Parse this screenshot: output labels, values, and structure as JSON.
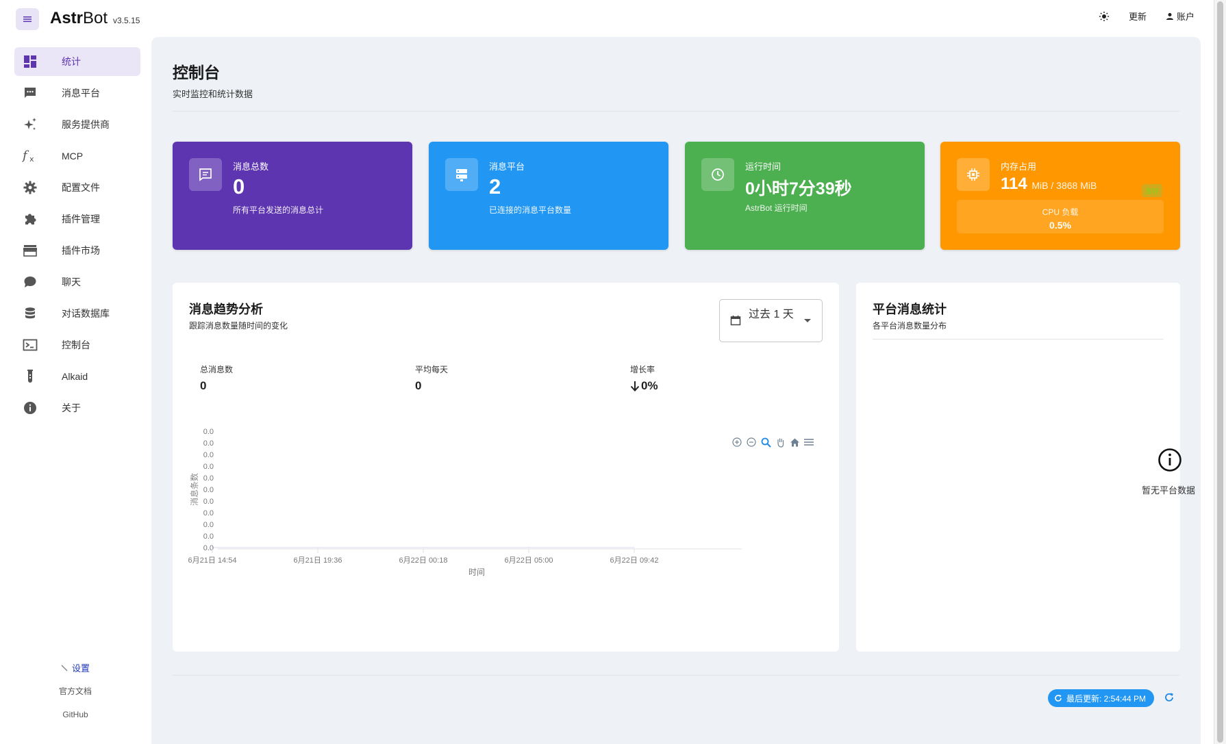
{
  "app": {
    "name_bold": "Astr",
    "name_rest": "Bot",
    "version": "v3.5.15"
  },
  "topbar": {
    "update_label": "更新",
    "account_label": "账户",
    "theme_icon": "sun-icon"
  },
  "sidebar": {
    "items": [
      {
        "label": "统计",
        "icon": "dashboard-icon"
      },
      {
        "label": "消息平台",
        "icon": "chat-bubble-icon"
      },
      {
        "label": "服务提供商",
        "icon": "sparkles-icon"
      },
      {
        "label": "MCP",
        "icon": "function-icon"
      },
      {
        "label": "配置文件",
        "icon": "gear-icon"
      },
      {
        "label": "插件管理",
        "icon": "puzzle-icon"
      },
      {
        "label": "插件市场",
        "icon": "store-icon"
      },
      {
        "label": "聊天",
        "icon": "comment-icon"
      },
      {
        "label": "对话数据库",
        "icon": "database-icon"
      },
      {
        "label": "控制台",
        "icon": "terminal-icon"
      },
      {
        "label": "Alkaid",
        "icon": "flask-icon"
      },
      {
        "label": "关于",
        "icon": "info-icon"
      }
    ],
    "settings_label": "设置",
    "docs_label": "官方文档",
    "github_label": "GitHub"
  },
  "page": {
    "title": "控制台",
    "subtitle": "实时监控和统计数据"
  },
  "stats": {
    "messages": {
      "title": "消息总数",
      "value": "0",
      "desc": "所有平台发送的消息总计"
    },
    "platforms": {
      "title": "消息平台",
      "value": "2",
      "desc": "已连接的消息平台数量"
    },
    "uptime": {
      "title": "运行时间",
      "value": "0小时7分39秒",
      "desc": "AstrBot 运行时间"
    },
    "memory": {
      "title": "内存占用",
      "value": "114",
      "unit": "MiB / 3868 MiB",
      "badge": "良好",
      "cpu_label": "CPU 负载",
      "cpu_value": "0.5%"
    }
  },
  "trend": {
    "title": "消息趋势分析",
    "subtitle": "跟踪消息数量随时间的变化",
    "range": "过去 1 天",
    "metrics": [
      {
        "label": "总消息数",
        "value": "0"
      },
      {
        "label": "平均每天",
        "value": "0"
      },
      {
        "label": "增长率",
        "value": "0%"
      }
    ]
  },
  "platform_stats": {
    "title": "平台消息统计",
    "subtitle": "各平台消息数量分布",
    "empty_text": "暂无平台数据"
  },
  "footer": {
    "last_update": "最后更新: 2:54:44 PM"
  },
  "colors": {
    "primary": "#5e35b1",
    "blue": "#2196f3",
    "green": "#4caf50",
    "orange": "#ff9800"
  },
  "chart_data": {
    "type": "area",
    "title": "",
    "xlabel": "时间",
    "ylabel": "消息条数",
    "x_ticks": [
      "6月21日 14:54",
      "6月21日 19:36",
      "6月22日 00:18",
      "6月22日 05:00",
      "6月22日 09:42"
    ],
    "y_ticks": [
      "0.0",
      "0.0",
      "0.0",
      "0.0",
      "0.0",
      "0.0",
      "0.0",
      "0.0",
      "0.0",
      "0.0",
      "0.0"
    ],
    "series": [
      {
        "values": [
          0,
          0,
          0,
          0,
          0
        ]
      }
    ],
    "grid": false
  }
}
